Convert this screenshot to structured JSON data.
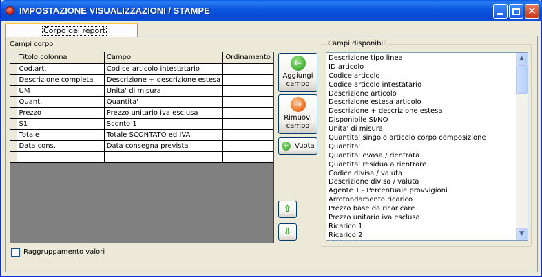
{
  "window": {
    "title": "IMPOSTAZIONE VISUALIZZAZIONI / STAMPE"
  },
  "tab": {
    "label": "Corpo del report"
  },
  "grid": {
    "label": "Campi corpo",
    "columns": [
      "Titolo colonna",
      "Campo",
      "Ordinamento"
    ],
    "rows": [
      [
        "Cod.art.",
        "Codice articolo intestatario",
        ""
      ],
      [
        "Descrizione completa",
        "Descrizione + descrizione estesa",
        ""
      ],
      [
        "UM",
        "Unita' di misura",
        ""
      ],
      [
        "Quant.",
        "Quantita'",
        ""
      ],
      [
        "Prezzo",
        "Prezzo unitario iva esclusa",
        ""
      ],
      [
        "S1",
        "Sconto 1",
        ""
      ],
      [
        "Totale",
        "Totale SCONTATO ed IVA",
        ""
      ],
      [
        "Data cons.",
        "Data consegna prevista",
        ""
      ],
      [
        "",
        "",
        ""
      ]
    ]
  },
  "buttons": {
    "add": "Aggiungi campo",
    "remove": "Rimuovi campo",
    "clear": "Vuota"
  },
  "available": {
    "label": "Campi disponibili",
    "items": [
      "Descrizione tipo linea",
      "ID articolo",
      "Codice articolo",
      "Codice articolo intestatario",
      "Descrizione articolo",
      "Descrizione estesa articolo",
      "Descrizione + descrizione estesa",
      "Disponibile SI/NO",
      "Unita' di misura",
      "Quantita' singolo articolo corpo composizione",
      "Quantita'",
      "Quantita' evasa / rientrata",
      "Quantita' residua a rientrare",
      "Codice divisa / valuta",
      "Descrizione divisa / valuta",
      "Agente 1 - Percentuale provvigioni",
      "Arrotondamento ricarico",
      "Prezzo base da ricaricare",
      "Prezzo unitario iva esclusa",
      "Ricarico 1",
      "Ricarico 2"
    ]
  },
  "grouping": {
    "label": "Raggruppamento valori",
    "checked": false
  },
  "colors": {
    "titlebar": "#0a56e0",
    "add_icon": "#4cb83c",
    "remove_icon": "#f07a2a"
  },
  "icons": [
    "app-icon",
    "minimize-icon",
    "maximize-icon",
    "close-icon",
    "arrow-left-icon",
    "arrow-right-icon",
    "plus-icon",
    "arrow-up-icon",
    "arrow-down-icon"
  ]
}
